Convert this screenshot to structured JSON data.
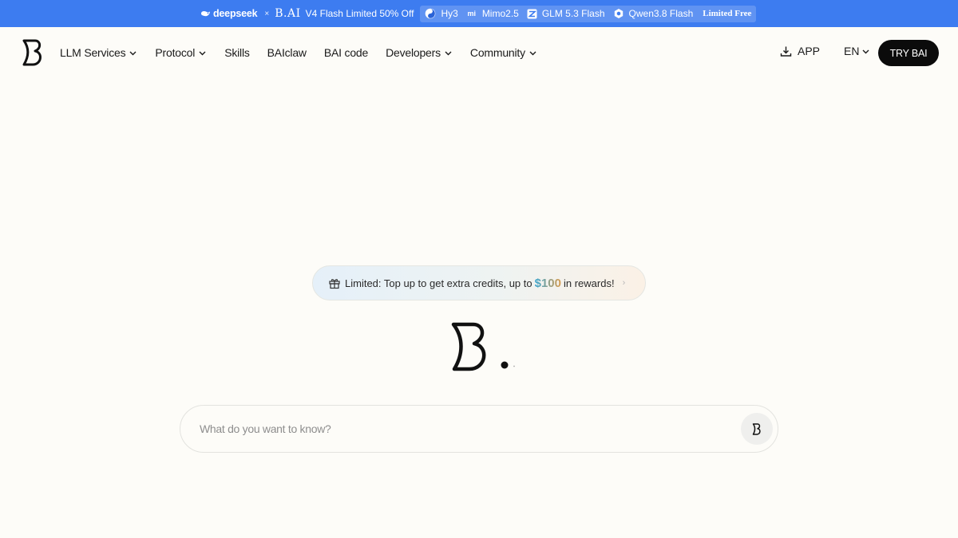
{
  "promo": {
    "brand_deepseek": "deepseek",
    "separator": "×",
    "brand_bai": "B.AI",
    "offer": "V4 Flash Limited 50% Off",
    "models": [
      {
        "name": "Hy3",
        "icon": "hunyuan-icon"
      },
      {
        "name": "Mimo2.5",
        "icon": "xiaomi-icon"
      },
      {
        "name": "GLM 5.3 Flash",
        "icon": "zhipu-icon"
      },
      {
        "name": "Qwen3.8 Flash",
        "icon": "qwen-icon"
      }
    ],
    "free_label": "Limited Free"
  },
  "nav": {
    "logo_icon": "bai-logo-icon",
    "items": [
      {
        "label": "LLM Services",
        "dropdown": true
      },
      {
        "label": "Protocol",
        "dropdown": true
      },
      {
        "label": "Skills",
        "dropdown": false
      },
      {
        "label": "BAIclaw",
        "dropdown": false
      },
      {
        "label": "BAI code",
        "dropdown": false
      },
      {
        "label": "Developers",
        "dropdown": true
      },
      {
        "label": "Community",
        "dropdown": true
      }
    ],
    "app_label": "APP",
    "lang_label": "EN",
    "try_label": "TRY BAI"
  },
  "hero": {
    "reward_prefix": "Limited: Top up to get extra credits, up to",
    "reward_amount": "$100",
    "reward_suffix": "in rewards!",
    "arrow": "›"
  },
  "search": {
    "placeholder": "What do you want to know?",
    "value": ""
  },
  "colors": {
    "banner": "#3d7cf0",
    "background": "#fdfcf8",
    "button": "#0b0b0b"
  }
}
